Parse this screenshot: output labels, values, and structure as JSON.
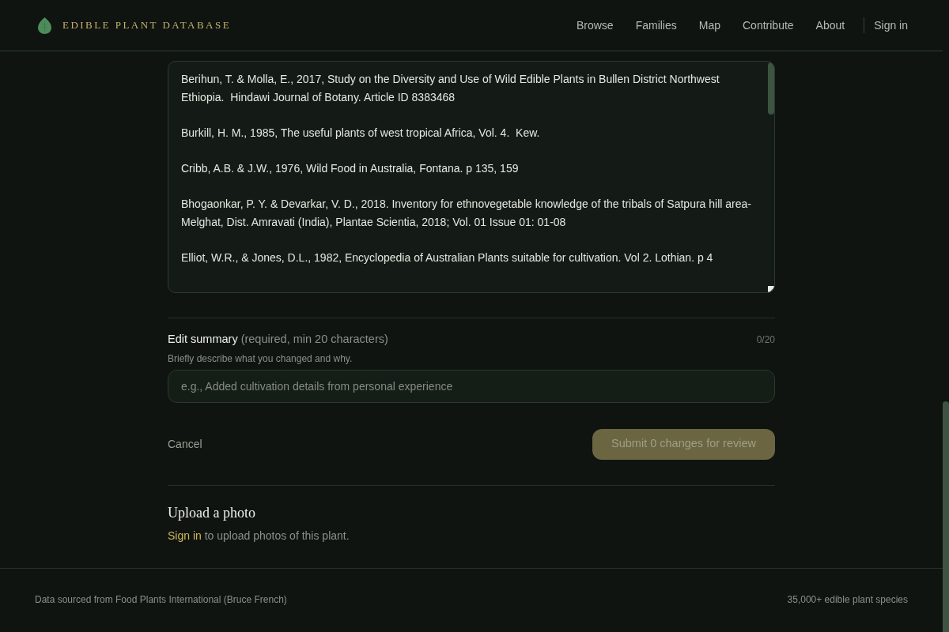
{
  "header": {
    "logo_text": "EDIBLE PLANT DATABASE",
    "nav": [
      "Browse",
      "Families",
      "Map",
      "Contribute",
      "About"
    ],
    "sign_in": "Sign in"
  },
  "references": {
    "items": [
      "Berihun, T. & Molla, E., 2017, Study on the Diversity and Use of Wild Edible Plants in Bullen District Northwest Ethiopia.  Hindawi Journal of Botany. Article ID 8383468",
      "Burkill, H. M., 1985, The useful plants of west tropical Africa, Vol. 4.  Kew.",
      "Cribb, A.B. & J.W., 1976, Wild Food in Australia, Fontana. p 135, 159",
      "Bhogaonkar, P. Y. & Devarkar, V. D., 2018. Inventory for ethnovegetable knowledge of the tribals of Satpura hill area-Melghat, Dist. Amravati (India), Plantae Scientia, 2018; Vol. 01 Issue 01: 01-08",
      "Elliot, W.R., & Jones, D.L., 1982, Encyclopedia of Australian Plants suitable for cultivation. Vol 2. Lothian. p 4"
    ]
  },
  "edit_summary": {
    "label": "Edit summary",
    "hint": "(required, min 20 characters)",
    "counter": "0/20",
    "help": "Briefly describe what you changed and why.",
    "placeholder": "e.g., Added cultivation details from personal experience"
  },
  "actions": {
    "cancel": "Cancel",
    "submit": {
      "label": "Submit 0 changes for review",
      "disabled": true
    }
  },
  "upload": {
    "title": "Upload a photo",
    "link": "Sign in",
    "text": "to upload photos of this plant."
  },
  "footer": {
    "source": "Data sourced from Food Plants International (Bruce French)",
    "count": "35,000+ edible plant species"
  }
}
